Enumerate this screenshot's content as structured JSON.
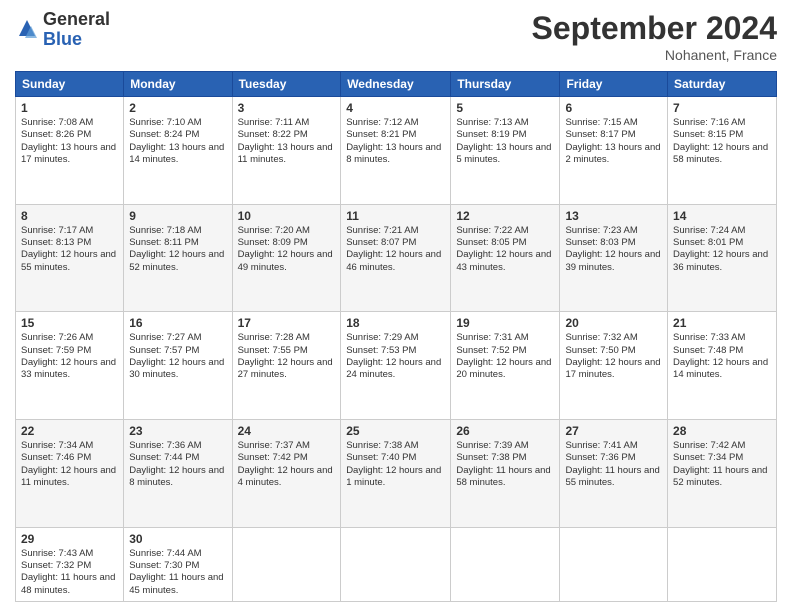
{
  "header": {
    "logo_general": "General",
    "logo_blue": "Blue",
    "month_title": "September 2024",
    "location": "Nohanent, France"
  },
  "days_of_week": [
    "Sunday",
    "Monday",
    "Tuesday",
    "Wednesday",
    "Thursday",
    "Friday",
    "Saturday"
  ],
  "weeks": [
    [
      {
        "day": "1",
        "sunrise": "7:08 AM",
        "sunset": "8:26 PM",
        "daylight": "13 hours and 17 minutes."
      },
      {
        "day": "2",
        "sunrise": "7:10 AM",
        "sunset": "8:24 PM",
        "daylight": "13 hours and 14 minutes."
      },
      {
        "day": "3",
        "sunrise": "7:11 AM",
        "sunset": "8:22 PM",
        "daylight": "13 hours and 11 minutes."
      },
      {
        "day": "4",
        "sunrise": "7:12 AM",
        "sunset": "8:21 PM",
        "daylight": "13 hours and 8 minutes."
      },
      {
        "day": "5",
        "sunrise": "7:13 AM",
        "sunset": "8:19 PM",
        "daylight": "13 hours and 5 minutes."
      },
      {
        "day": "6",
        "sunrise": "7:15 AM",
        "sunset": "8:17 PM",
        "daylight": "13 hours and 2 minutes."
      },
      {
        "day": "7",
        "sunrise": "7:16 AM",
        "sunset": "8:15 PM",
        "daylight": "12 hours and 58 minutes."
      }
    ],
    [
      {
        "day": "8",
        "sunrise": "7:17 AM",
        "sunset": "8:13 PM",
        "daylight": "12 hours and 55 minutes."
      },
      {
        "day": "9",
        "sunrise": "7:18 AM",
        "sunset": "8:11 PM",
        "daylight": "12 hours and 52 minutes."
      },
      {
        "day": "10",
        "sunrise": "7:20 AM",
        "sunset": "8:09 PM",
        "daylight": "12 hours and 49 minutes."
      },
      {
        "day": "11",
        "sunrise": "7:21 AM",
        "sunset": "8:07 PM",
        "daylight": "12 hours and 46 minutes."
      },
      {
        "day": "12",
        "sunrise": "7:22 AM",
        "sunset": "8:05 PM",
        "daylight": "12 hours and 43 minutes."
      },
      {
        "day": "13",
        "sunrise": "7:23 AM",
        "sunset": "8:03 PM",
        "daylight": "12 hours and 39 minutes."
      },
      {
        "day": "14",
        "sunrise": "7:24 AM",
        "sunset": "8:01 PM",
        "daylight": "12 hours and 36 minutes."
      }
    ],
    [
      {
        "day": "15",
        "sunrise": "7:26 AM",
        "sunset": "7:59 PM",
        "daylight": "12 hours and 33 minutes."
      },
      {
        "day": "16",
        "sunrise": "7:27 AM",
        "sunset": "7:57 PM",
        "daylight": "12 hours and 30 minutes."
      },
      {
        "day": "17",
        "sunrise": "7:28 AM",
        "sunset": "7:55 PM",
        "daylight": "12 hours and 27 minutes."
      },
      {
        "day": "18",
        "sunrise": "7:29 AM",
        "sunset": "7:53 PM",
        "daylight": "12 hours and 24 minutes."
      },
      {
        "day": "19",
        "sunrise": "7:31 AM",
        "sunset": "7:52 PM",
        "daylight": "12 hours and 20 minutes."
      },
      {
        "day": "20",
        "sunrise": "7:32 AM",
        "sunset": "7:50 PM",
        "daylight": "12 hours and 17 minutes."
      },
      {
        "day": "21",
        "sunrise": "7:33 AM",
        "sunset": "7:48 PM",
        "daylight": "12 hours and 14 minutes."
      }
    ],
    [
      {
        "day": "22",
        "sunrise": "7:34 AM",
        "sunset": "7:46 PM",
        "daylight": "12 hours and 11 minutes."
      },
      {
        "day": "23",
        "sunrise": "7:36 AM",
        "sunset": "7:44 PM",
        "daylight": "12 hours and 8 minutes."
      },
      {
        "day": "24",
        "sunrise": "7:37 AM",
        "sunset": "7:42 PM",
        "daylight": "12 hours and 4 minutes."
      },
      {
        "day": "25",
        "sunrise": "7:38 AM",
        "sunset": "7:40 PM",
        "daylight": "12 hours and 1 minute."
      },
      {
        "day": "26",
        "sunrise": "7:39 AM",
        "sunset": "7:38 PM",
        "daylight": "11 hours and 58 minutes."
      },
      {
        "day": "27",
        "sunrise": "7:41 AM",
        "sunset": "7:36 PM",
        "daylight": "11 hours and 55 minutes."
      },
      {
        "day": "28",
        "sunrise": "7:42 AM",
        "sunset": "7:34 PM",
        "daylight": "11 hours and 52 minutes."
      }
    ],
    [
      {
        "day": "29",
        "sunrise": "7:43 AM",
        "sunset": "7:32 PM",
        "daylight": "11 hours and 48 minutes."
      },
      {
        "day": "30",
        "sunrise": "7:44 AM",
        "sunset": "7:30 PM",
        "daylight": "11 hours and 45 minutes."
      },
      null,
      null,
      null,
      null,
      null
    ]
  ]
}
